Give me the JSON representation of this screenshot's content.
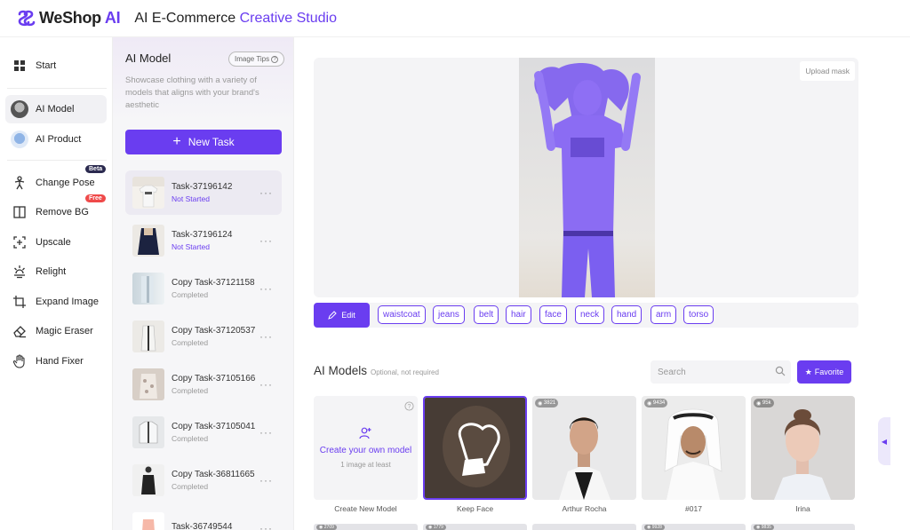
{
  "header": {
    "logo_prefix": "WeShop",
    "logo_suffix": "AI",
    "title_plain": "AI E-Commerce",
    "title_accent": "Creative Studio"
  },
  "nav": {
    "items": [
      {
        "label": "Start",
        "icon": "grid-icon"
      },
      {
        "label": "AI Model",
        "icon": "model-avatar-icon",
        "active": true
      },
      {
        "label": "AI Product",
        "icon": "product-avatar-icon"
      },
      {
        "label": "Change Pose",
        "icon": "pose-icon",
        "badge": "Beta"
      },
      {
        "label": "Remove BG",
        "icon": "book-icon",
        "badge": "Free"
      },
      {
        "label": "Upscale",
        "icon": "upscale-icon"
      },
      {
        "label": "Relight",
        "icon": "relight-icon"
      },
      {
        "label": "Expand Image",
        "icon": "crop-icon"
      },
      {
        "label": "Magic Eraser",
        "icon": "eraser-icon"
      },
      {
        "label": "Hand Fixer",
        "icon": "hand-icon"
      }
    ]
  },
  "tasks": {
    "title": "AI Model",
    "tips": "Image Tips",
    "description": "Showcase clothing with a variety of models that aligns with your brand's aesthetic",
    "new_task": "New Task",
    "list": [
      {
        "name": "Task-37196142",
        "status": "Not Started"
      },
      {
        "name": "Task-37196124",
        "status": "Not Started"
      },
      {
        "name": "Copy Task-37121158",
        "status": "Completed"
      },
      {
        "name": "Copy Task-37120537",
        "status": "Completed"
      },
      {
        "name": "Copy Task-37105166",
        "status": "Completed"
      },
      {
        "name": "Copy Task-37105041",
        "status": "Completed"
      },
      {
        "name": "Copy Task-36811665",
        "status": "Completed"
      },
      {
        "name": "Task-36749544",
        "status": ""
      }
    ]
  },
  "canvas": {
    "upload_mask": "Upload mask",
    "edit": "Edit",
    "tags": [
      "waistcoat",
      "jeans",
      "belt",
      "hair",
      "face",
      "neck",
      "hand",
      "arm",
      "torso"
    ]
  },
  "models": {
    "title": "AI Models",
    "subtitle": "Optional, not required",
    "search_placeholder": "Search",
    "favorite": "Favorite",
    "create_title": "Create your own model",
    "create_sub": "1 image at least",
    "cards": [
      {
        "label": "Create New Model",
        "count": ""
      },
      {
        "label": "Keep Face",
        "count": ""
      },
      {
        "label": "Arthur Rocha",
        "count": "3821"
      },
      {
        "label": "#017",
        "count": "9434"
      },
      {
        "label": "Irina",
        "count": "95k"
      }
    ],
    "row2_counts": [
      "2709",
      "1779",
      "",
      "9928",
      "9835"
    ]
  },
  "colors": {
    "accent": "#6a3df0",
    "beta": "#2b2a4f",
    "free": "#ef4a4a"
  }
}
